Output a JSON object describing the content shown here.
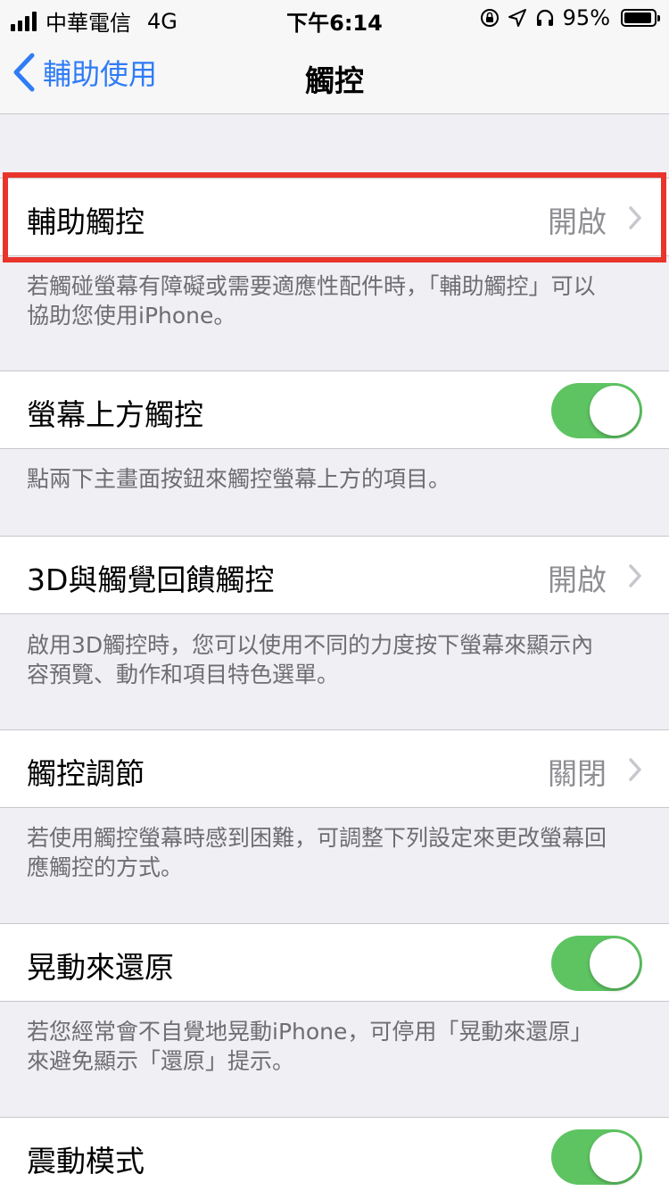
{
  "status_bar": {
    "carrier": "中華電信",
    "network": "4G",
    "time": "下午6:14",
    "battery": "95%",
    "icons": [
      "signal-icon",
      "rotation-lock-icon",
      "location-icon",
      "headphones-icon",
      "battery-icon"
    ]
  },
  "nav": {
    "back_label": "輔助使用",
    "title": "觸控"
  },
  "rows": {
    "assistive_touch": {
      "label": "輔助觸控",
      "value": "開啟"
    },
    "reachability": {
      "label": "螢幕上方觸控",
      "toggle": "on"
    },
    "touch_3d": {
      "label": "3D與觸覺回饋觸控",
      "value": "開啟"
    },
    "touch_accommodations": {
      "label": "觸控調節",
      "value": "關閉"
    },
    "shake_to_undo": {
      "label": "晃動來還原",
      "toggle": "on"
    },
    "vibration": {
      "label": "震動模式",
      "toggle": "on"
    }
  },
  "notes": {
    "assistive_touch": [
      "若觸碰螢幕有障礙或需要適應性配件時，「輔助觸控」可以",
      "協助您使用iPhone。"
    ],
    "reachability": [
      "點兩下主畫面按鈕來觸控螢幕上方的項目。"
    ],
    "touch_3d": [
      "啟用3D觸控時，您可以使用不同的力度按下螢幕來顯示內",
      "容預覽、動作和項目特色選單。"
    ],
    "touch_accommodations": [
      "若使用觸控螢幕時感到困難，可調整下列設定來更改螢幕回",
      "應觸控的方式。"
    ],
    "shake_to_undo": [
      "若您經常會不自覺地晃動iPhone，可停用「晃動來還原」",
      "來避免顯示「還原」提示。"
    ]
  },
  "colors": {
    "accent": "#2f7cf6",
    "toggle_on": "#5ec462",
    "highlight": "#e8342b",
    "background": "#efeff4"
  }
}
